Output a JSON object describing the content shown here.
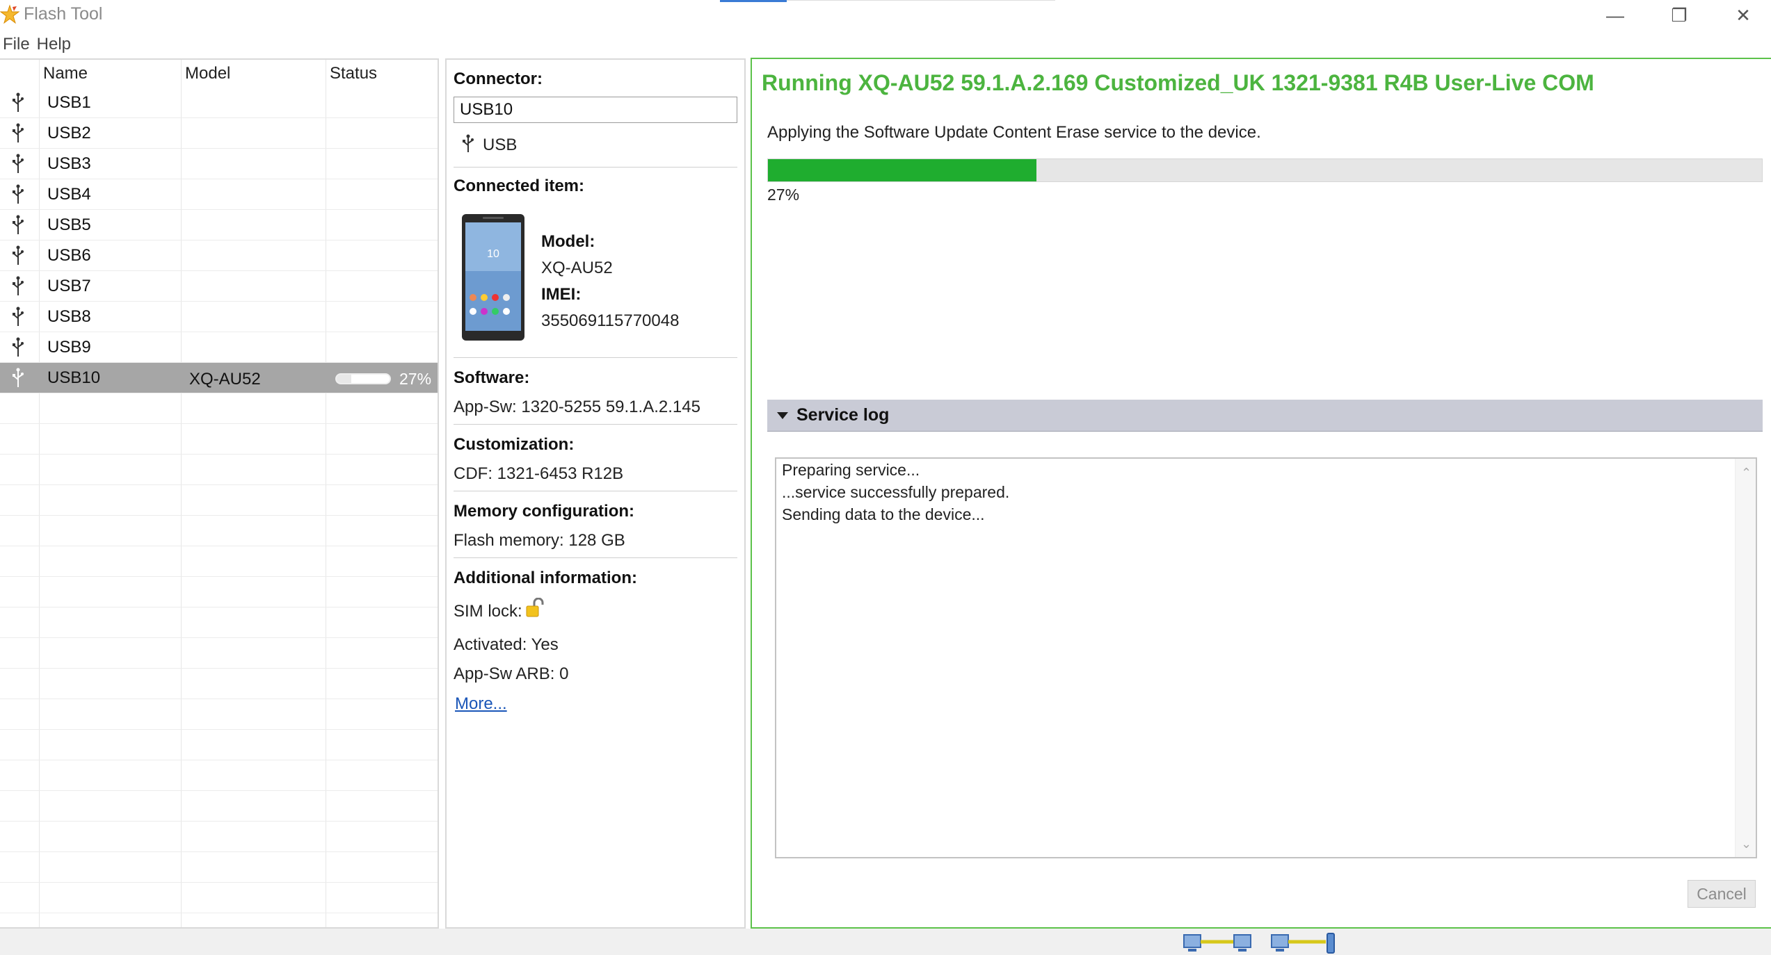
{
  "window": {
    "title": "Flash Tool",
    "min_glyph": "—",
    "max_glyph": "❐",
    "close_glyph": "✕"
  },
  "menu": [
    "File",
    "Help"
  ],
  "device_list": {
    "columns": [
      "Name",
      "Model",
      "Status"
    ],
    "rows": [
      {
        "name": "USB1"
      },
      {
        "name": "USB2"
      },
      {
        "name": "USB3"
      },
      {
        "name": "USB4"
      },
      {
        "name": "USB5"
      },
      {
        "name": "USB6"
      },
      {
        "name": "USB7"
      },
      {
        "name": "USB8"
      },
      {
        "name": "USB9"
      },
      {
        "name": "USB10",
        "model": "XQ-AU52",
        "status_pct": "27%",
        "progress": 0.27,
        "selected": true
      }
    ]
  },
  "details": {
    "connector_label": "Connector:",
    "connector_value": "USB10",
    "connector_type": "USB",
    "connected_item_label": "Connected item:",
    "model_label": "Model:",
    "model_value": "XQ-AU52",
    "imei_label": "IMEI:",
    "imei_value": "355069115770048",
    "software_label": "Software:",
    "software_value": "App-Sw: 1320-5255 59.1.A.2.145",
    "customization_label": "Customization:",
    "customization_value": "CDF: 1321-6453 R12B",
    "memory_label": "Memory configuration:",
    "memory_value": "Flash memory: 128 GB",
    "additional_label": "Additional information:",
    "sim_lock": "SIM lock:",
    "activated": "Activated: Yes",
    "arb": "App-Sw ARB: 0",
    "more_link": "More..."
  },
  "run": {
    "title": "Running XQ-AU52 59.1.A.2.169 Customized_UK 1321-9381 R4B User-Live COM",
    "message": "Applying the Software Update Content Erase service to the device.",
    "progress": 0.27,
    "progress_text": "27%",
    "log_title": "Service log",
    "log_lines": [
      "Preparing service...",
      "...service successfully prepared.",
      "Sending data to the device..."
    ],
    "cancel_label": "Cancel"
  },
  "colors": {
    "accent_green": "#4cb43f",
    "progress_green": "#1fad2f",
    "selection_gray": "#a6a6a6",
    "link_blue": "#1a56b8"
  }
}
